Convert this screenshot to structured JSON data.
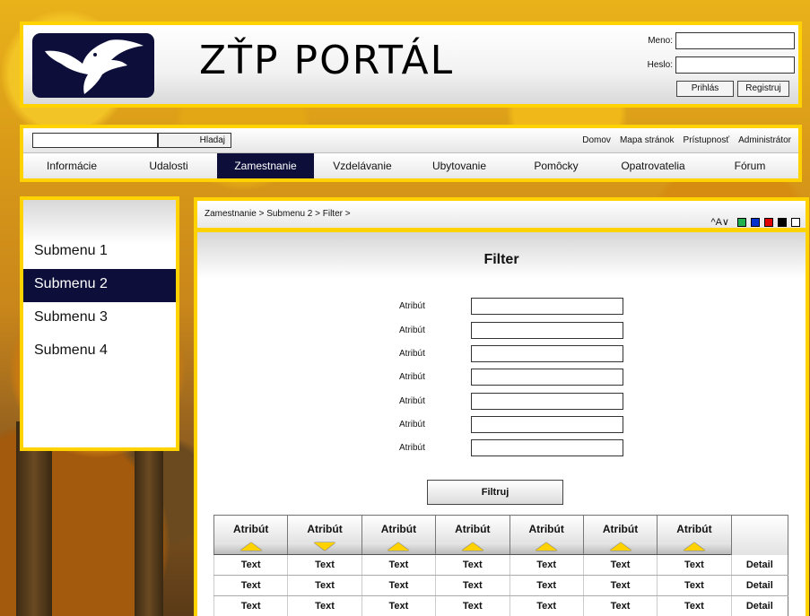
{
  "header": {
    "site_title": "ZŤP PORTÁL",
    "login": {
      "name_label": "Meno:",
      "password_label": "Heslo:",
      "login_button": "Prihlás",
      "register_button": "Registruj"
    }
  },
  "toolbar": {
    "search_button": "Hladaj",
    "links": [
      "Domov",
      "Mapa stránok",
      "Prístupnosť",
      "Administrátor"
    ]
  },
  "nav": {
    "items": [
      "Informácie",
      "Udalosti",
      "Zamestnanie",
      "Vzdelávanie",
      "Ubytovanie",
      "Pomôcky",
      "Opatrovatelia",
      "Fórum"
    ],
    "active": "Zamestnanie"
  },
  "sidebar": {
    "items": [
      "Submenu 1",
      "Submenu 2",
      "Submenu 3",
      "Submenu 4"
    ],
    "active": "Submenu 2"
  },
  "breadcrumb": {
    "text": "Zamestnanie > Submenu 2 > Filter >",
    "font_adjust": "^A∨",
    "swatches": [
      "#22b14c",
      "#0033cc",
      "#e00000",
      "#000000",
      "#ffffff"
    ]
  },
  "filter": {
    "title": "Filter",
    "fields": [
      "Atribút",
      "Atribút",
      "Atribút",
      "Atribút",
      "Atribút",
      "Atribút",
      "Atribút"
    ],
    "button": "Filtruj"
  },
  "table": {
    "headers": [
      "Atribút",
      "Atribút",
      "Atribút",
      "Atribút",
      "Atribút",
      "Atribút",
      "Atribút"
    ],
    "sort": [
      "up",
      "down",
      "up",
      "up",
      "up",
      "up",
      "up"
    ],
    "rows": [
      [
        "Text",
        "Text",
        "Text",
        "Text",
        "Text",
        "Text",
        "Text",
        "Detail"
      ],
      [
        "Text",
        "Text",
        "Text",
        "Text",
        "Text",
        "Text",
        "Text",
        "Detail"
      ],
      [
        "Text",
        "Text",
        "Text",
        "Text",
        "Text",
        "Text",
        "Text",
        "Detail"
      ]
    ]
  }
}
